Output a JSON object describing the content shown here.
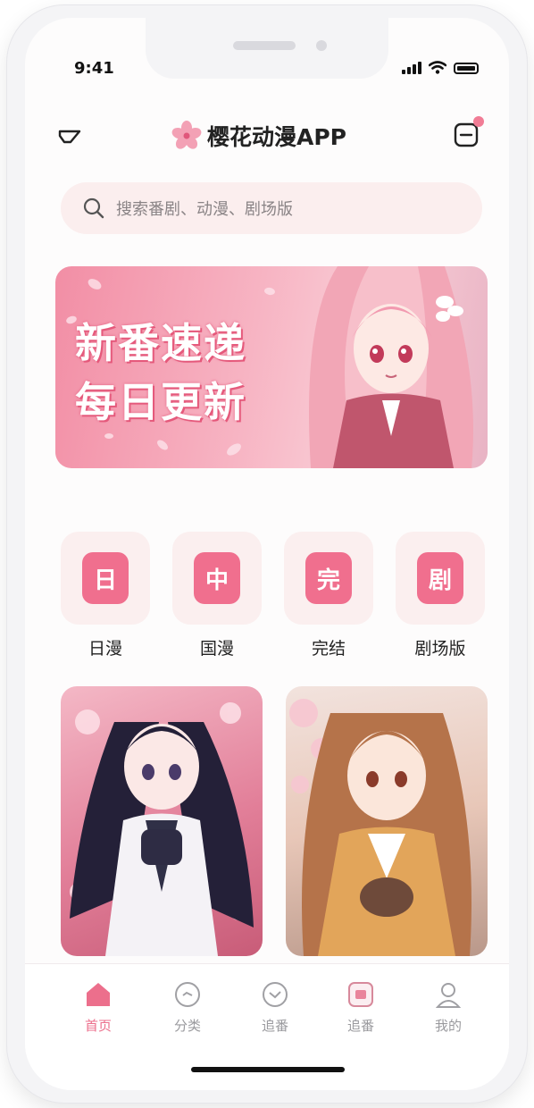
{
  "status_bar": {
    "time": "9:41"
  },
  "app": {
    "title": "樱花动漫APP"
  },
  "search": {
    "placeholder": "搜索番剧、动漫、剧场版"
  },
  "banner": {
    "line1": "新番速递",
    "line2": "每日更新"
  },
  "categories": [
    {
      "label": "日漫",
      "glyph": "日"
    },
    {
      "label": "国漫",
      "glyph": "中"
    },
    {
      "label": "完结",
      "glyph": "完"
    },
    {
      "label": "剧场版",
      "glyph": "剧"
    }
  ],
  "tabs": [
    {
      "label": "首页",
      "icon": "home-icon"
    },
    {
      "label": "分类",
      "icon": "category-icon"
    },
    {
      "label": "追番",
      "icon": "follow-icon"
    },
    {
      "label": "追番",
      "icon": "play-icon"
    },
    {
      "label": "我的",
      "icon": "user-icon"
    }
  ],
  "colors": {
    "accent": "#ec6f8c",
    "tile_bg": "#fbefef",
    "search_bg": "#fbeeee"
  }
}
